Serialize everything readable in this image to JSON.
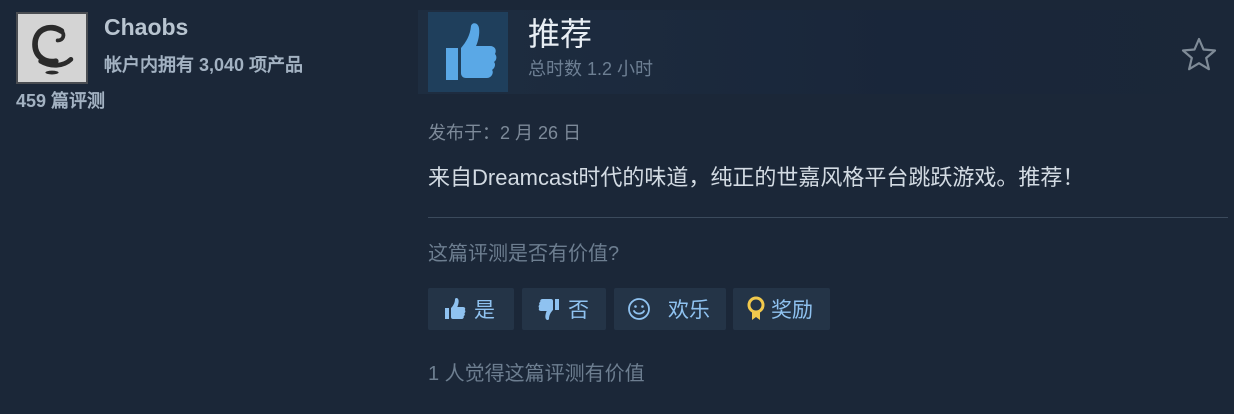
{
  "author": {
    "name": "Chaobs",
    "products_owned": "帐户内拥有 3,040 项产品",
    "review_count": "459 篇评测",
    "avatar_icon": "cobra-logo-avatar"
  },
  "review": {
    "verdict": "推荐",
    "verdict_icon": "thumbs-up-icon",
    "playtime": "总时数 1.2 小时",
    "posted_date": "发布于：2 月 26 日",
    "text": "来自Dreamcast时代的味道，纯正的世嘉风格平台跳跃游戏。推荐！",
    "favorite_icon": "star-icon"
  },
  "feedback": {
    "question": "这篇评测是否有价值?",
    "buttons": {
      "yes": "是",
      "no": "否",
      "funny": "欢乐",
      "award": "奖励"
    },
    "helpful_count": "1 人觉得这篇评测有价值"
  },
  "colors": {
    "background": "#1b2738",
    "button_bg": "#243447",
    "button_text": "#8fc2f0",
    "thumb_box": "#1f3f5c",
    "thumb_icon": "#5aa8e6",
    "award_icon": "#f2c94c"
  }
}
